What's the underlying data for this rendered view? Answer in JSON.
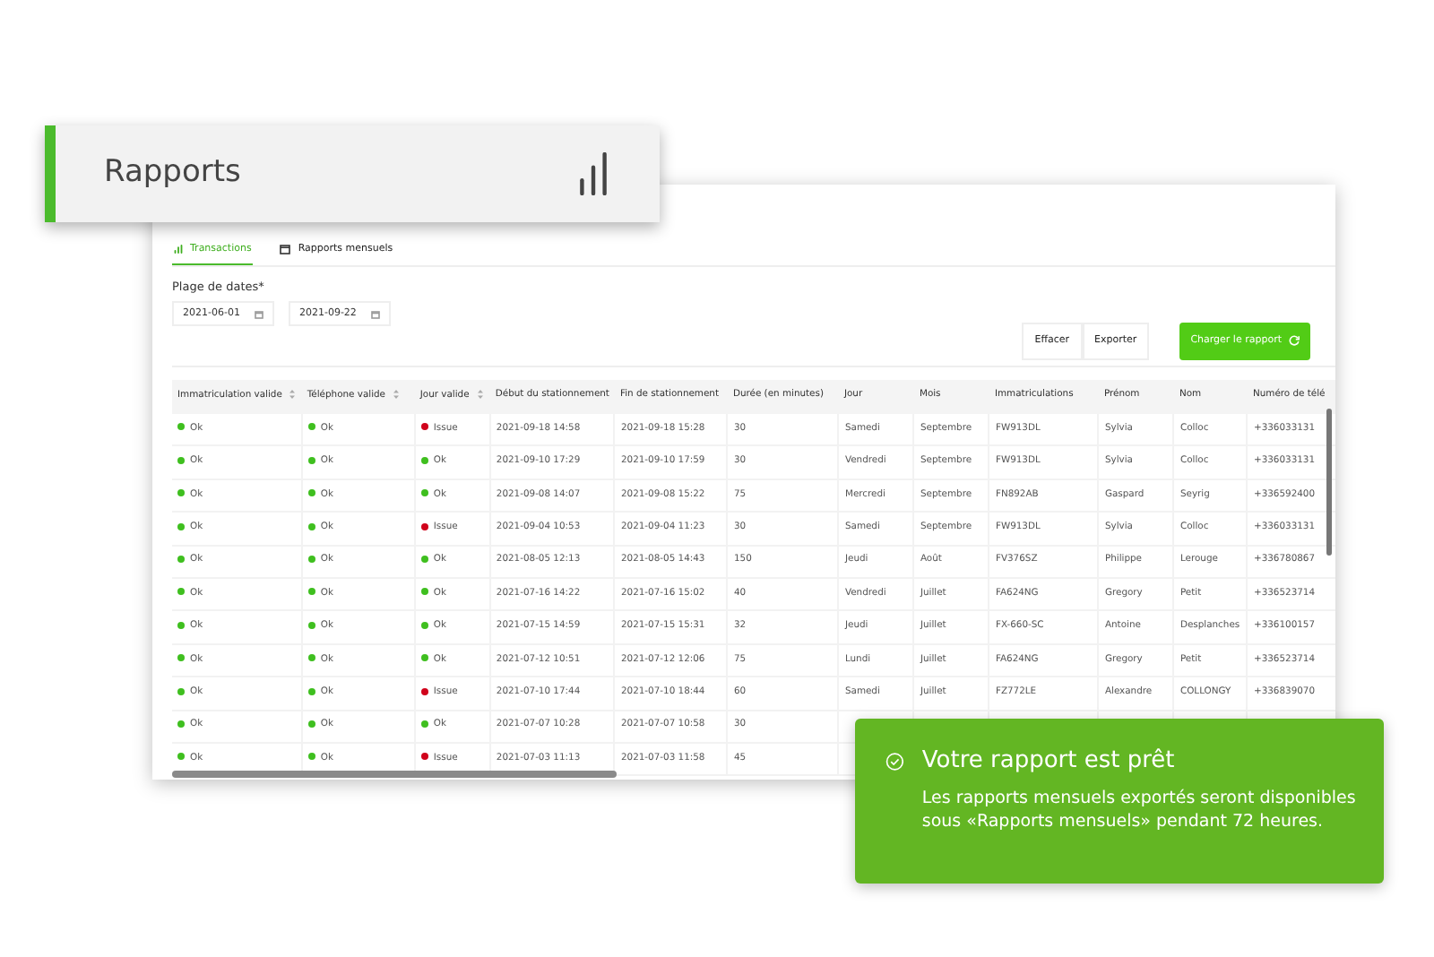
{
  "header": {
    "title": "Rapports"
  },
  "tabs": [
    {
      "label": "Transactions",
      "selected": true
    },
    {
      "label": "Rapports mensuels",
      "selected": false
    }
  ],
  "date_range": {
    "label": "Plage de dates*",
    "start": "2021-06-01",
    "end": "2021-09-22"
  },
  "actions": [
    {
      "label": "Effacer",
      "kind": "plain"
    },
    {
      "label": "Exporter",
      "kind": "plain"
    },
    {
      "label": "Charger le rapport",
      "kind": "primary"
    }
  ],
  "table": {
    "columns": [
      {
        "label": "Immatriculation valide",
        "sortable": true
      },
      {
        "label": "Téléphone valide",
        "sortable": true
      },
      {
        "label": "Jour valide",
        "sortable": true
      },
      {
        "label": "Début du stationnement",
        "sortable": false
      },
      {
        "label": "Fin de stationnement",
        "sortable": false
      },
      {
        "label": "Durée (en minutes)",
        "sortable": false
      },
      {
        "label": "Jour",
        "sortable": false
      },
      {
        "label": "Mois",
        "sortable": false
      },
      {
        "label": "Immatriculations",
        "sortable": false
      },
      {
        "label": "Prénom",
        "sortable": false
      },
      {
        "label": "Nom",
        "sortable": false
      },
      {
        "label": "Numéro de télé",
        "sortable": false
      }
    ],
    "rows": [
      {
        "cells": [
          {
            "text": "Ok",
            "color": "#3fbf1f"
          },
          {
            "text": "Ok",
            "color": "#3fbf1f"
          },
          {
            "text": "Issue",
            "color": "#d0021b"
          },
          "2021-09-18 14:58",
          "2021-09-18 15:28",
          "30",
          "Samedi",
          "Septembre",
          "FW913DL",
          "Sylvia",
          "Colloc",
          "+336033131"
        ]
      },
      {
        "cells": [
          {
            "text": "Ok",
            "color": "#3fbf1f"
          },
          {
            "text": "Ok",
            "color": "#3fbf1f"
          },
          {
            "text": "Ok",
            "color": "#3fbf1f"
          },
          "2021-09-10 17:29",
          "2021-09-10 17:59",
          "30",
          "Vendredi",
          "Septembre",
          "FW913DL",
          "Sylvia",
          "Colloc",
          "+336033131"
        ]
      },
      {
        "cells": [
          {
            "text": "Ok",
            "color": "#3fbf1f"
          },
          {
            "text": "Ok",
            "color": "#3fbf1f"
          },
          {
            "text": "Ok",
            "color": "#3fbf1f"
          },
          "2021-09-08 14:07",
          "2021-09-08 15:22",
          "75",
          "Mercredi",
          "Septembre",
          "FN892AB",
          "Gaspard",
          "Seyrig",
          "+336592400"
        ]
      },
      {
        "cells": [
          {
            "text": "Ok",
            "color": "#3fbf1f"
          },
          {
            "text": "Ok",
            "color": "#3fbf1f"
          },
          {
            "text": "Issue",
            "color": "#d0021b"
          },
          "2021-09-04 10:53",
          "2021-09-04 11:23",
          "30",
          "Samedi",
          "Septembre",
          "FW913DL",
          "Sylvia",
          "Colloc",
          "+336033131"
        ]
      },
      {
        "cells": [
          {
            "text": "Ok",
            "color": "#3fbf1f"
          },
          {
            "text": "Ok",
            "color": "#3fbf1f"
          },
          {
            "text": "Ok",
            "color": "#3fbf1f"
          },
          "2021-08-05 12:13",
          "2021-08-05 14:43",
          "150",
          "Jeudi",
          "Août",
          "FV376SZ",
          "Philippe",
          "Lerouge",
          "+336780867"
        ]
      },
      {
        "cells": [
          {
            "text": "Ok",
            "color": "#3fbf1f"
          },
          {
            "text": "Ok",
            "color": "#3fbf1f"
          },
          {
            "text": "Ok",
            "color": "#3fbf1f"
          },
          "2021-07-16 14:22",
          "2021-07-16 15:02",
          "40",
          "Vendredi",
          "Juillet",
          "FA624NG",
          "Gregory",
          "Petit",
          "+336523714"
        ]
      },
      {
        "cells": [
          {
            "text": "Ok",
            "color": "#3fbf1f"
          },
          {
            "text": "Ok",
            "color": "#3fbf1f"
          },
          {
            "text": "Ok",
            "color": "#3fbf1f"
          },
          "2021-07-15 14:59",
          "2021-07-15 15:31",
          "32",
          "Jeudi",
          "Juillet",
          "FX-660-SC",
          "Antoine",
          "Desplanches",
          "+336100157"
        ]
      },
      {
        "cells": [
          {
            "text": "Ok",
            "color": "#3fbf1f"
          },
          {
            "text": "Ok",
            "color": "#3fbf1f"
          },
          {
            "text": "Ok",
            "color": "#3fbf1f"
          },
          "2021-07-12 10:51",
          "2021-07-12 12:06",
          "75",
          "Lundi",
          "Juillet",
          "FA624NG",
          "Gregory",
          "Petit",
          "+336523714"
        ]
      },
      {
        "cells": [
          {
            "text": "Ok",
            "color": "#3fbf1f"
          },
          {
            "text": "Ok",
            "color": "#3fbf1f"
          },
          {
            "text": "Issue",
            "color": "#d0021b"
          },
          "2021-07-10 17:44",
          "2021-07-10 18:44",
          "60",
          "Samedi",
          "Juillet",
          "FZ772LE",
          "Alexandre",
          "COLLONGY",
          "+336839070"
        ]
      },
      {
        "cells": [
          {
            "text": "Ok",
            "color": "#3fbf1f"
          },
          {
            "text": "Ok",
            "color": "#3fbf1f"
          },
          {
            "text": "Ok",
            "color": "#3fbf1f"
          },
          "2021-07-07 10:28",
          "2021-07-07 10:58",
          "30"
        ]
      },
      {
        "cells": [
          {
            "text": "Ok",
            "color": "#3fbf1f"
          },
          {
            "text": "Ok",
            "color": "#3fbf1f"
          },
          {
            "text": "Issue",
            "color": "#d0021b"
          },
          "2021-07-03 11:13",
          "2021-07-03 11:58",
          "45"
        ]
      }
    ]
  },
  "toast": {
    "title": "Votre rapport est prêt",
    "message": "Les rapports mensuels exportés seront disponibles sous «Rapports mensuels» pendant 72 heures."
  }
}
